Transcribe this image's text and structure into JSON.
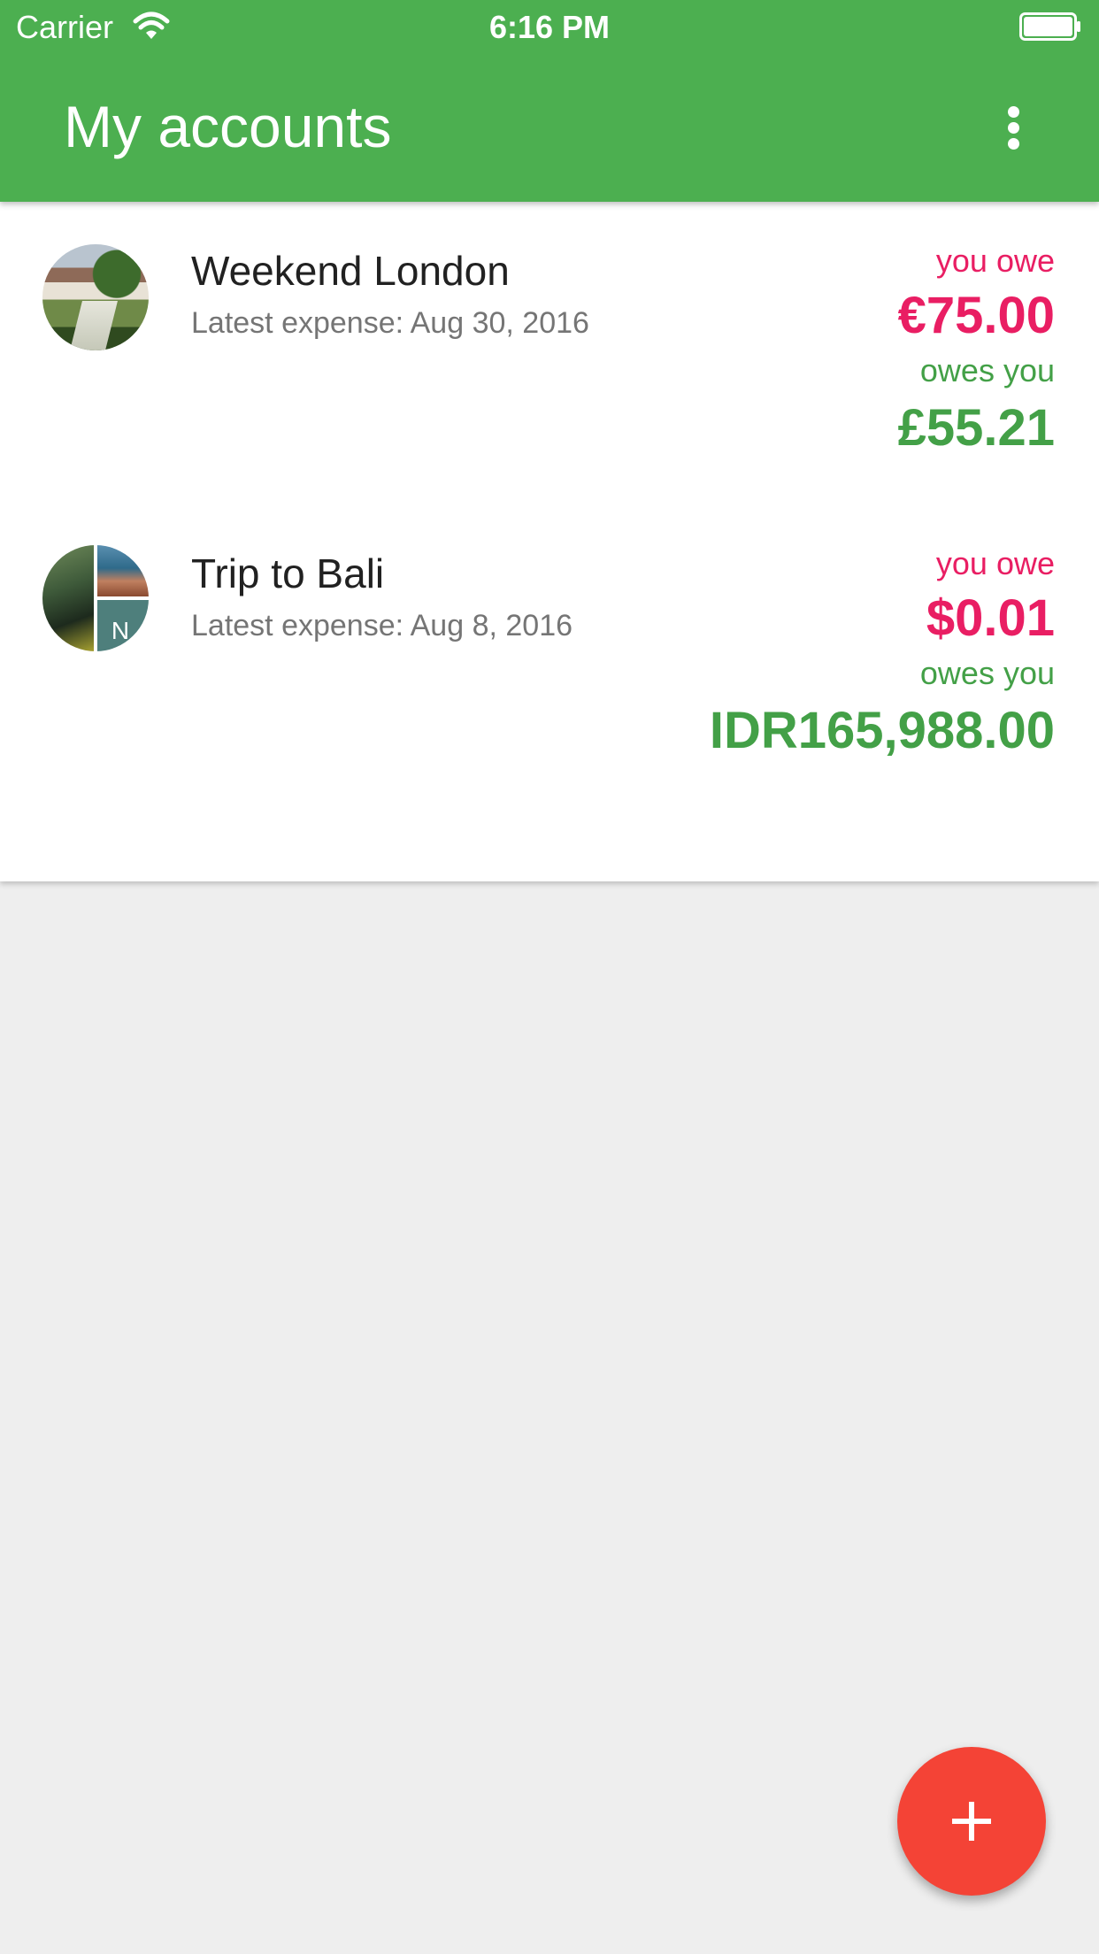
{
  "status_bar": {
    "carrier": "Carrier",
    "time": "6:16 PM",
    "wifi_icon": "wifi-icon",
    "battery_icon": "battery-icon"
  },
  "header": {
    "title": "My accounts",
    "menu_icon": "more-vert-icon"
  },
  "accounts": [
    {
      "name": "Weekend London",
      "latest": "Latest expense: Aug 30, 2016",
      "you_owe_label": "you owe",
      "you_owe_amount": "€75.00",
      "owes_you_label": "owes you",
      "owes_you_amount": "£55.21"
    },
    {
      "name": "Trip to Bali",
      "latest": "Latest expense: Aug 8, 2016",
      "avatar_initial": "N",
      "you_owe_label": "you owe",
      "you_owe_amount": "$0.01",
      "owes_you_label": "owes you",
      "owes_you_amount": "IDR165,988.00"
    }
  ],
  "fab": {
    "icon": "plus-icon"
  },
  "colors": {
    "header": "#4caf50",
    "owe": "#e91e63",
    "owed": "#43a047",
    "fab": "#f44336",
    "background": "#eeeeee"
  }
}
